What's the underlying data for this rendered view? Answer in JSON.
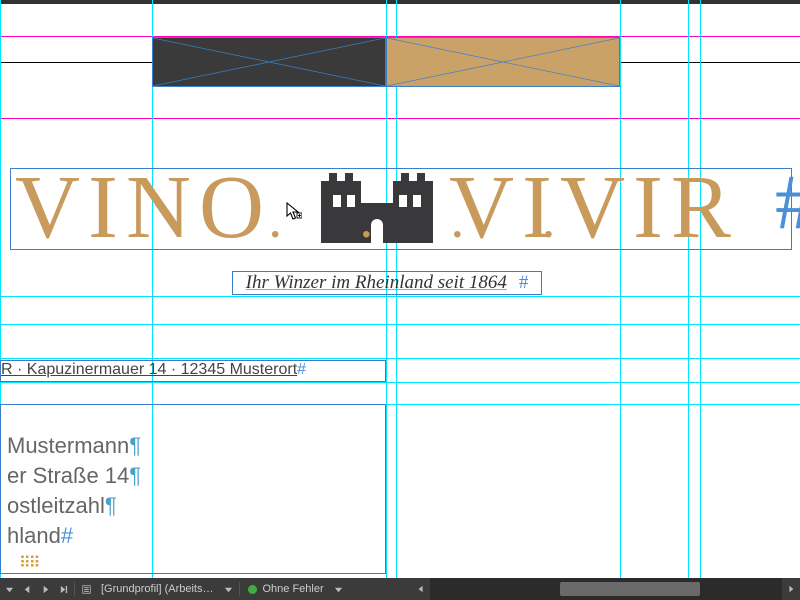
{
  "colors": {
    "gold": "#c89a5c",
    "dark": "#3a3a3a",
    "tan": "#caa268",
    "guide": "#00e5ff"
  },
  "logo": {
    "left_word": "VINO",
    "right_word": "VIVIR",
    "hash_char": "#",
    "castle_icon": "castle-icon"
  },
  "tagline": {
    "text": "Ihr Winzer im Rheinland seit 1864",
    "hash": "#"
  },
  "sender": {
    "text": "R · Kapuzinermauer 14 · 12345 Musterort",
    "hash": "#"
  },
  "address": {
    "lines": [
      "Mustermann",
      "er Straße 14",
      "ostleitzahl",
      "hland"
    ],
    "pilcrow": "¶",
    "hash": "#"
  },
  "statusbar": {
    "profile_label": "[Grundprofil] (Arbeits…",
    "errors_label": "Ohne Fehler",
    "errors_dot_color": "#3fae3f",
    "nav": {
      "first": "first-page",
      "prev": "prev-page",
      "next": "next-page",
      "last": "last-page"
    }
  }
}
